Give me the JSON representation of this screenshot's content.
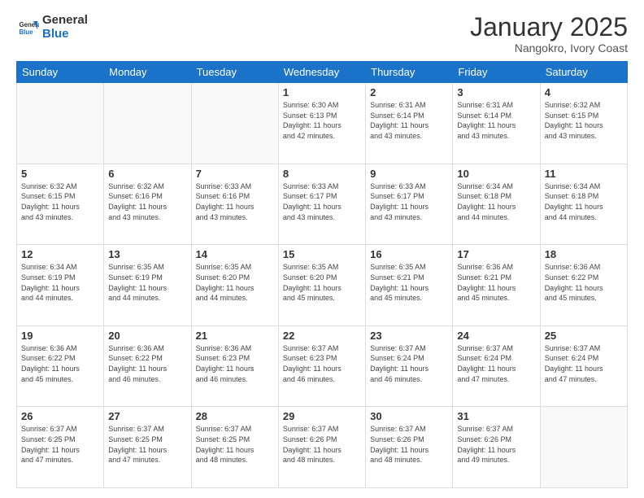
{
  "logo": {
    "line1": "General",
    "line2": "Blue"
  },
  "header": {
    "month": "January 2025",
    "location": "Nangokro, Ivory Coast"
  },
  "days_of_week": [
    "Sunday",
    "Monday",
    "Tuesday",
    "Wednesday",
    "Thursday",
    "Friday",
    "Saturday"
  ],
  "weeks": [
    [
      {
        "day": "",
        "info": ""
      },
      {
        "day": "",
        "info": ""
      },
      {
        "day": "",
        "info": ""
      },
      {
        "day": "1",
        "info": "Sunrise: 6:30 AM\nSunset: 6:13 PM\nDaylight: 11 hours\nand 42 minutes."
      },
      {
        "day": "2",
        "info": "Sunrise: 6:31 AM\nSunset: 6:14 PM\nDaylight: 11 hours\nand 43 minutes."
      },
      {
        "day": "3",
        "info": "Sunrise: 6:31 AM\nSunset: 6:14 PM\nDaylight: 11 hours\nand 43 minutes."
      },
      {
        "day": "4",
        "info": "Sunrise: 6:32 AM\nSunset: 6:15 PM\nDaylight: 11 hours\nand 43 minutes."
      }
    ],
    [
      {
        "day": "5",
        "info": "Sunrise: 6:32 AM\nSunset: 6:15 PM\nDaylight: 11 hours\nand 43 minutes."
      },
      {
        "day": "6",
        "info": "Sunrise: 6:32 AM\nSunset: 6:16 PM\nDaylight: 11 hours\nand 43 minutes."
      },
      {
        "day": "7",
        "info": "Sunrise: 6:33 AM\nSunset: 6:16 PM\nDaylight: 11 hours\nand 43 minutes."
      },
      {
        "day": "8",
        "info": "Sunrise: 6:33 AM\nSunset: 6:17 PM\nDaylight: 11 hours\nand 43 minutes."
      },
      {
        "day": "9",
        "info": "Sunrise: 6:33 AM\nSunset: 6:17 PM\nDaylight: 11 hours\nand 43 minutes."
      },
      {
        "day": "10",
        "info": "Sunrise: 6:34 AM\nSunset: 6:18 PM\nDaylight: 11 hours\nand 44 minutes."
      },
      {
        "day": "11",
        "info": "Sunrise: 6:34 AM\nSunset: 6:18 PM\nDaylight: 11 hours\nand 44 minutes."
      }
    ],
    [
      {
        "day": "12",
        "info": "Sunrise: 6:34 AM\nSunset: 6:19 PM\nDaylight: 11 hours\nand 44 minutes."
      },
      {
        "day": "13",
        "info": "Sunrise: 6:35 AM\nSunset: 6:19 PM\nDaylight: 11 hours\nand 44 minutes."
      },
      {
        "day": "14",
        "info": "Sunrise: 6:35 AM\nSunset: 6:20 PM\nDaylight: 11 hours\nand 44 minutes."
      },
      {
        "day": "15",
        "info": "Sunrise: 6:35 AM\nSunset: 6:20 PM\nDaylight: 11 hours\nand 45 minutes."
      },
      {
        "day": "16",
        "info": "Sunrise: 6:35 AM\nSunset: 6:21 PM\nDaylight: 11 hours\nand 45 minutes."
      },
      {
        "day": "17",
        "info": "Sunrise: 6:36 AM\nSunset: 6:21 PM\nDaylight: 11 hours\nand 45 minutes."
      },
      {
        "day": "18",
        "info": "Sunrise: 6:36 AM\nSunset: 6:22 PM\nDaylight: 11 hours\nand 45 minutes."
      }
    ],
    [
      {
        "day": "19",
        "info": "Sunrise: 6:36 AM\nSunset: 6:22 PM\nDaylight: 11 hours\nand 45 minutes."
      },
      {
        "day": "20",
        "info": "Sunrise: 6:36 AM\nSunset: 6:22 PM\nDaylight: 11 hours\nand 46 minutes."
      },
      {
        "day": "21",
        "info": "Sunrise: 6:36 AM\nSunset: 6:23 PM\nDaylight: 11 hours\nand 46 minutes."
      },
      {
        "day": "22",
        "info": "Sunrise: 6:37 AM\nSunset: 6:23 PM\nDaylight: 11 hours\nand 46 minutes."
      },
      {
        "day": "23",
        "info": "Sunrise: 6:37 AM\nSunset: 6:24 PM\nDaylight: 11 hours\nand 46 minutes."
      },
      {
        "day": "24",
        "info": "Sunrise: 6:37 AM\nSunset: 6:24 PM\nDaylight: 11 hours\nand 47 minutes."
      },
      {
        "day": "25",
        "info": "Sunrise: 6:37 AM\nSunset: 6:24 PM\nDaylight: 11 hours\nand 47 minutes."
      }
    ],
    [
      {
        "day": "26",
        "info": "Sunrise: 6:37 AM\nSunset: 6:25 PM\nDaylight: 11 hours\nand 47 minutes."
      },
      {
        "day": "27",
        "info": "Sunrise: 6:37 AM\nSunset: 6:25 PM\nDaylight: 11 hours\nand 47 minutes."
      },
      {
        "day": "28",
        "info": "Sunrise: 6:37 AM\nSunset: 6:25 PM\nDaylight: 11 hours\nand 48 minutes."
      },
      {
        "day": "29",
        "info": "Sunrise: 6:37 AM\nSunset: 6:26 PM\nDaylight: 11 hours\nand 48 minutes."
      },
      {
        "day": "30",
        "info": "Sunrise: 6:37 AM\nSunset: 6:26 PM\nDaylight: 11 hours\nand 48 minutes."
      },
      {
        "day": "31",
        "info": "Sunrise: 6:37 AM\nSunset: 6:26 PM\nDaylight: 11 hours\nand 49 minutes."
      },
      {
        "day": "",
        "info": ""
      }
    ]
  ]
}
